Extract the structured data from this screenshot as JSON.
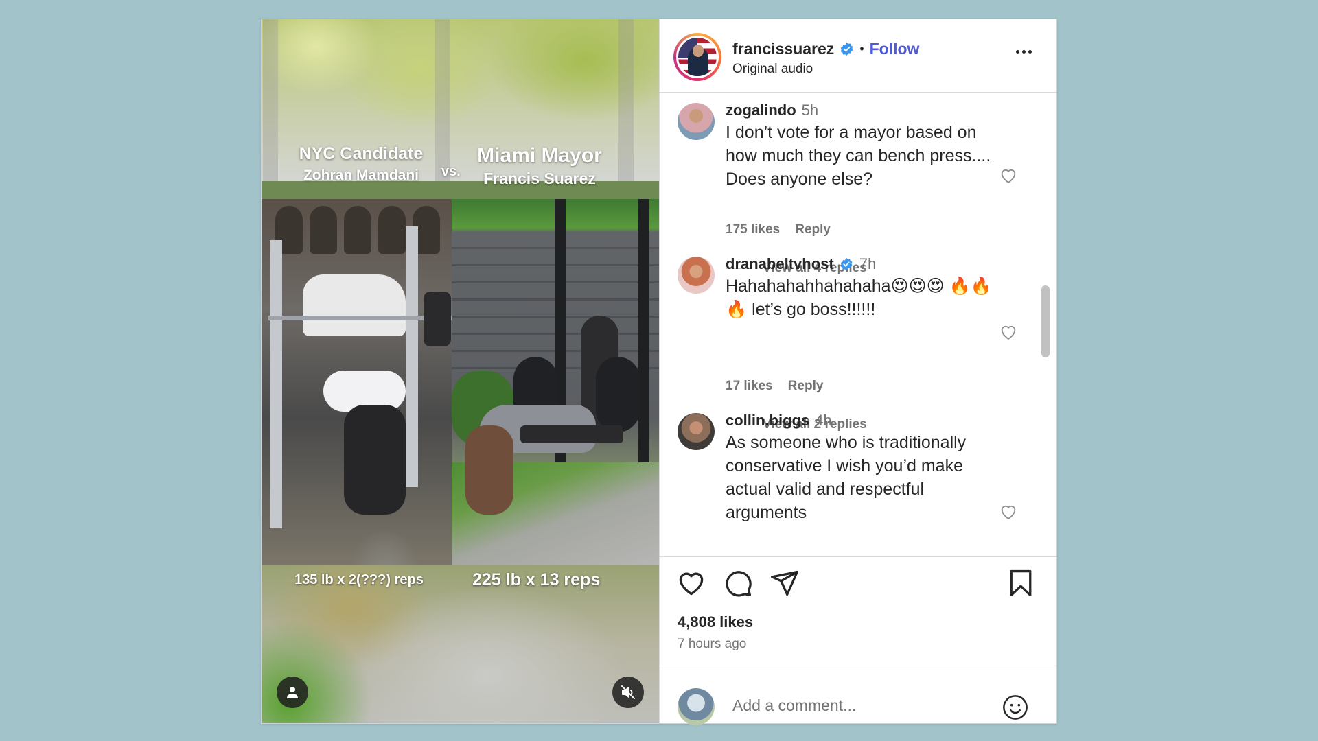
{
  "media": {
    "caption_left_line1": "NYC Candidate",
    "caption_left_line2": "Zohran Mamdani",
    "caption_vs": "vs.",
    "caption_right_line1": "Miami Mayor",
    "caption_right_line2": "Francis Suarez",
    "rep_left": "135 lb x 2(???) reps",
    "rep_right": "225 lb x 13 reps",
    "user_icon": "person-icon",
    "mute_icon": "muted-speaker-icon"
  },
  "header": {
    "username": "francissuarez",
    "verified_icon": "verified-badge-icon",
    "separator": "•",
    "follow_label": "Follow",
    "subtitle": "Original audio",
    "more_icon": "more-options-icon"
  },
  "comments": [
    {
      "username": "zogalindo",
      "time": "5h",
      "text": "I don’t vote for a mayor based on how much they can bench press.... Does anyone else?",
      "likes": "175 likes",
      "reply": "Reply",
      "view_replies": "View all 4 replies"
    },
    {
      "username": "dranabeltvhost",
      "verified": true,
      "time": "7h",
      "text": "Hahahahahhahahaha😍😍😍 🔥🔥🔥 let’s go boss!!!!!!",
      "likes": "17 likes",
      "reply": "Reply",
      "view_replies": "View all 2 replies"
    },
    {
      "username": "collin.biggs",
      "time": "4h",
      "text": "As someone who is traditionally conservative I wish you’d make actual valid and respectful arguments"
    }
  ],
  "actions": {
    "like_icon": "heart-icon",
    "comment_icon": "comment-bubble-icon",
    "share_icon": "paper-plane-icon",
    "save_icon": "bookmark-icon"
  },
  "likes": "4,808 likes",
  "time_ago": "7 hours ago",
  "add_comment": {
    "placeholder": "Add a comment...",
    "emoji_icon": "smiley-face-icon"
  },
  "colors": {
    "background": "#a3c3cb",
    "follow_link": "#4f5bd5",
    "verified": "#3897f0",
    "text_primary": "#262626",
    "text_secondary": "#737373"
  }
}
